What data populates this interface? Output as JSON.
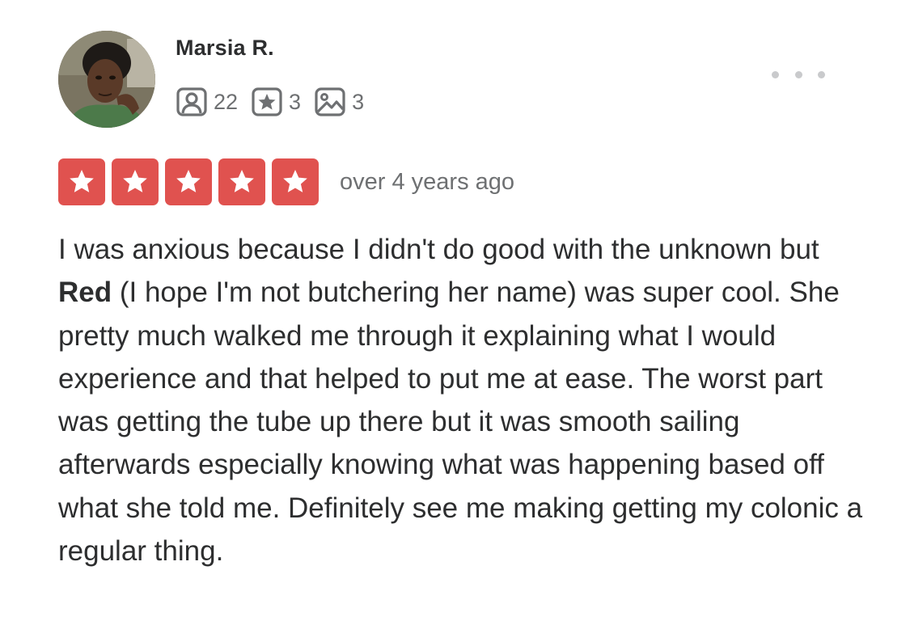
{
  "user": {
    "name": "Marsia R.",
    "stats": [
      {
        "icon": "friends-icon",
        "value": "22"
      },
      {
        "icon": "review-star-icon",
        "value": "3"
      },
      {
        "icon": "photo-icon",
        "value": "3"
      }
    ]
  },
  "review": {
    "rating": 5,
    "max_rating": 5,
    "date": "over 4 years ago",
    "text_before": "I was anxious because I didn't do good with the unknown but ",
    "text_bold": "Red",
    "text_after": " (I hope I'm not butchering her name)  was super cool. She pretty much walked me through it explaining what I would experience and that helped to put me at ease. The worst part was getting the tube up there but it was smooth sailing afterwards especially knowing what was happening based off what she told me. Definitely see me making getting my colonic a regular thing."
  },
  "colors": {
    "star_red": "#e0524f",
    "text_dark": "#2d2e2f",
    "text_gray": "#6e7072"
  }
}
